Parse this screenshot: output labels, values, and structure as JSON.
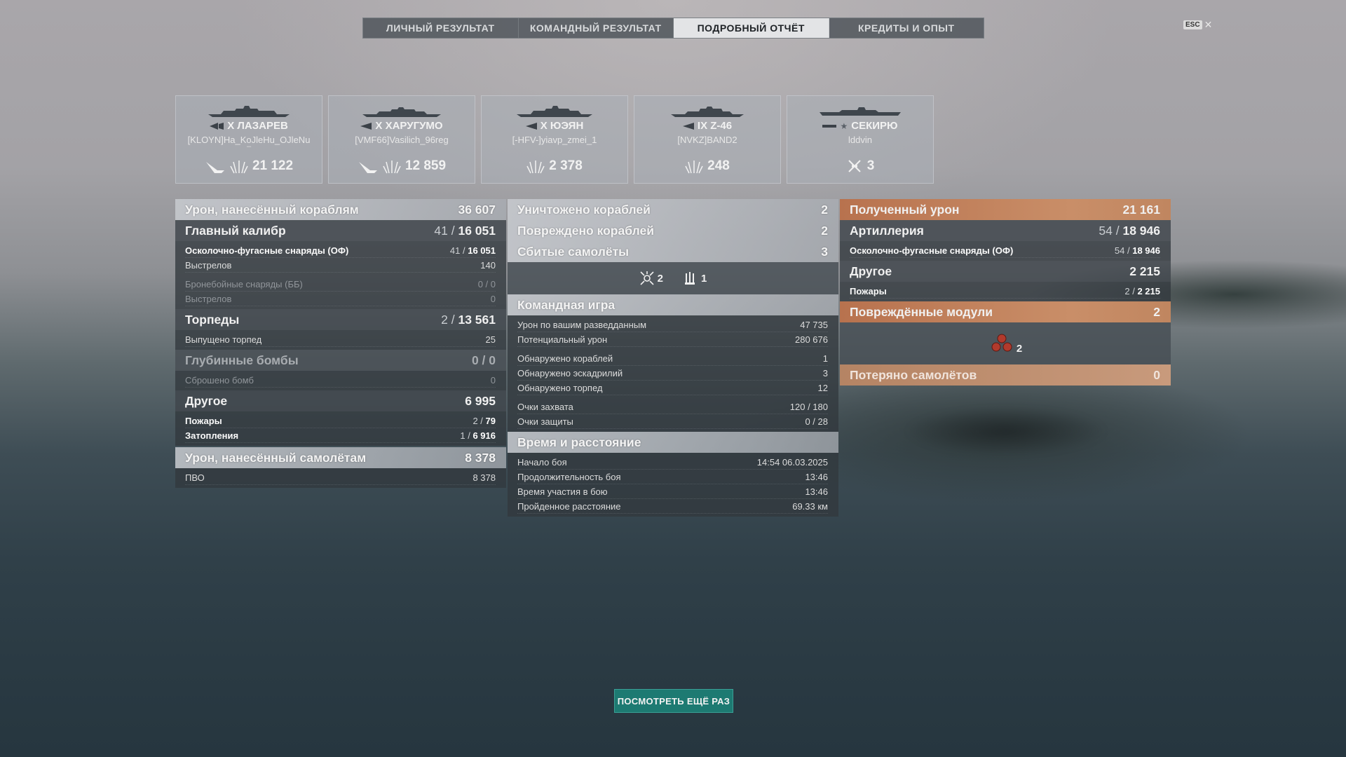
{
  "tabs": [
    {
      "label": "ЛИЧНЫЙ РЕЗУЛЬТАТ",
      "active": false
    },
    {
      "label": "КОМАНДНЫЙ РЕЗУЛЬТАТ",
      "active": false
    },
    {
      "label": "ПОДРОБНЫЙ ОТЧЁТ",
      "active": true
    },
    {
      "label": "КРЕДИТЫ И ОПЫТ",
      "active": false
    }
  ],
  "esc": {
    "key": "ESC",
    "close": "✕"
  },
  "ships": [
    {
      "name": "X ЛАЗАРЕВ",
      "player": "[KLOYN]Ha_KoJleHu_OJleNu",
      "extra": "–",
      "stat": "21 122",
      "icons": [
        "ribbon-torpedo-hit-icon",
        "ribbon-shell-hit-icon"
      ]
    },
    {
      "name": "X ХАРУГУМО",
      "player": "[VMF66]Vasilich_96reg",
      "stat": "12 859",
      "icons": [
        "ribbon-torpedo-hit-icon",
        "ribbon-shell-hit-icon"
      ]
    },
    {
      "name": "X ЮЭЯН",
      "player": "[-HFV-]yiavp_zmei_1",
      "stat": "2 378",
      "icons": [
        "ribbon-shell-hit-icon"
      ]
    },
    {
      "name": "IX Z-46",
      "player": "[NVKZ]BAND2",
      "stat": "248",
      "icons": [
        "ribbon-shell-hit-icon"
      ]
    },
    {
      "name": "СЕКИРЮ",
      "player": "lddvin",
      "stat": "3",
      "icons": [
        "plane-shot-down-icon"
      ]
    }
  ],
  "left": {
    "ship_damage": {
      "label": "Урон, нанесённый кораблям",
      "value": "36 607"
    },
    "main_battery": {
      "label": "Главный калибр",
      "hits": "41",
      "value": "16 051"
    },
    "he_shells": {
      "label": "Осколочно-фугасные снаряды (ОФ)",
      "hits": "41",
      "value": "16 051"
    },
    "he_shots": {
      "label": "Выстрелов",
      "value": "140"
    },
    "ap_shells": {
      "label": "Бронебойные снаряды (ББ)",
      "value": "0 / 0"
    },
    "ap_shots": {
      "label": "Выстрелов",
      "value": "0"
    },
    "torpedoes": {
      "label": "Торпеды",
      "hits": "2",
      "value": "13 561"
    },
    "torps_launched": {
      "label": "Выпущено торпед",
      "value": "25"
    },
    "depth_charges": {
      "label": "Глубинные бомбы",
      "value": "0 / 0"
    },
    "bombs_dropped": {
      "label": "Сброшено бомб",
      "value": "0"
    },
    "other": {
      "label": "Другое",
      "value": "6 995"
    },
    "fires": {
      "label": "Пожары",
      "count": "2",
      "value": "79"
    },
    "floods": {
      "label": "Затопления",
      "count": "1",
      "value": "6 916"
    },
    "plane_damage": {
      "label": "Урон, нанесённый самолётам",
      "value": "8 378"
    },
    "aa": {
      "label": "ПВО",
      "value": "8 378"
    }
  },
  "middle": {
    "destroyed": {
      "label": "Уничтожено кораблей",
      "value": "2"
    },
    "damaged": {
      "label": "Повреждено кораблей",
      "value": "2"
    },
    "planes_shot": {
      "label": "Сбитые самолёты",
      "value": "3"
    },
    "planes_icons": [
      {
        "icon": "fighter-plane-icon",
        "count": "2"
      },
      {
        "icon": "aa-gun-icon",
        "count": "1"
      }
    ],
    "team_play": {
      "label": "Командная игра"
    },
    "spotting_damage": {
      "label": "Урон по вашим разведданным",
      "value": "47 735"
    },
    "potential_damage": {
      "label": "Потенциальный урон",
      "value": "280 676"
    },
    "ships_spotted": {
      "label": "Обнаружено кораблей",
      "value": "1"
    },
    "squadrons_spotted": {
      "label": "Обнаружено эскадрилий",
      "value": "3"
    },
    "torps_spotted": {
      "label": "Обнаружено торпед",
      "value": "12"
    },
    "capture_points": {
      "label": "Очки захвата",
      "value": "120 / 180"
    },
    "defense_points": {
      "label": "Очки защиты",
      "value": "0 / 28"
    },
    "time_distance": {
      "label": "Время и расстояние"
    },
    "battle_start": {
      "label": "Начало боя",
      "value": "14:54  06.03.2025"
    },
    "battle_duration": {
      "label": "Продолжительность боя",
      "value": "13:46"
    },
    "time_in_battle": {
      "label": "Время участия в бою",
      "value": "13:46"
    },
    "distance": {
      "label": "Пройденное расстояние",
      "value": "69.33 км"
    }
  },
  "right": {
    "received": {
      "label": "Полученный урон",
      "value": "21 161"
    },
    "artillery": {
      "label": "Артиллерия",
      "hits": "54",
      "value": "18 946"
    },
    "he_received": {
      "label": "Осколочно-фугасные снаряды (ОФ)",
      "hits": "54",
      "value": "18 946"
    },
    "other": {
      "label": "Другое",
      "value": "2 215"
    },
    "fires": {
      "label": "Пожары",
      "count": "2",
      "value": "2 215"
    },
    "modules": {
      "label": "Повреждённые модули",
      "value": "2",
      "icon": "damaged-module-icon",
      "count": "2"
    },
    "planes_lost": {
      "label": "Потеряно самолётов",
      "value": "0"
    }
  },
  "replay_button": "ПОСМОТРЕТЬ ЕЩЁ РАЗ",
  "colors": {
    "accent_orange": "#c08660",
    "replay_teal": "#1d7a72",
    "active_tab": "#e3e4e6"
  }
}
